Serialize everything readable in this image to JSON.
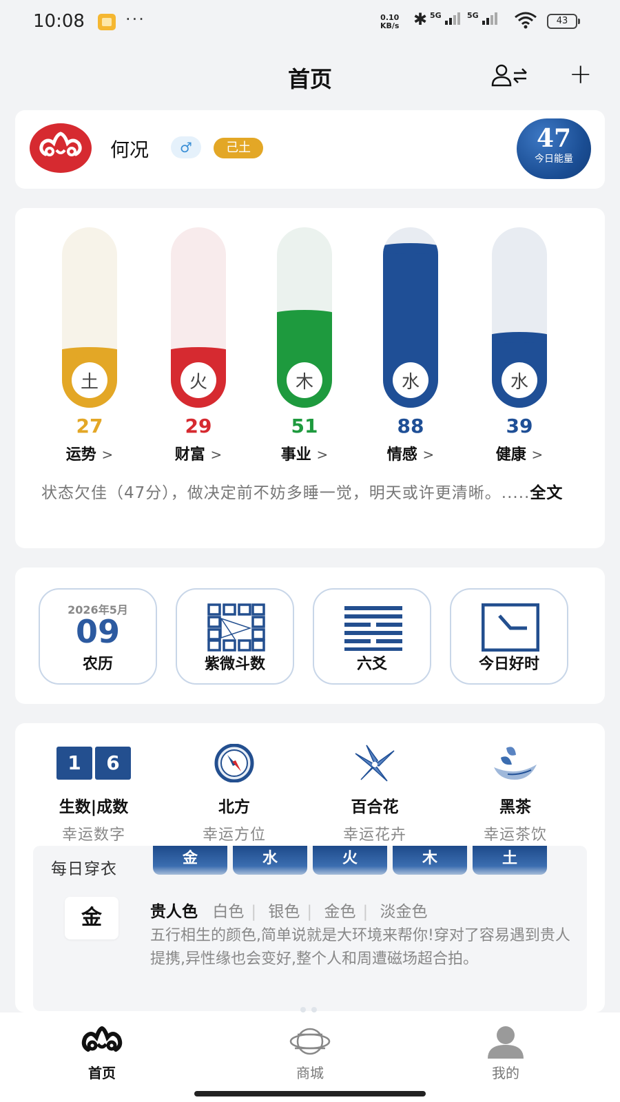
{
  "status_bar": {
    "time": "10:08",
    "net_speed_value": "0.10",
    "net_speed_unit": "KB/s",
    "sig1": "5G",
    "sig2": "5G",
    "battery": "43"
  },
  "header": {
    "title": "首页"
  },
  "profile": {
    "name": "何况",
    "gender_symbol": "♂",
    "element": "己土",
    "energy_value": "47",
    "energy_label": "今日能量"
  },
  "fortune": {
    "items": [
      {
        "element": "土",
        "score": "27",
        "label": "运势",
        "level": 0.27,
        "color": "#e3a726",
        "track": "#f7f3e9"
      },
      {
        "element": "火",
        "score": "29",
        "label": "财富",
        "level": 0.29,
        "color": "#d62a30",
        "track": "#f8ebec"
      },
      {
        "element": "木",
        "score": "51",
        "label": "事业",
        "level": 0.51,
        "color": "#1e9a3e",
        "track": "#ebf2ee"
      },
      {
        "element": "水",
        "score": "88",
        "label": "情感",
        "level": 0.88,
        "color": "#1f4f96",
        "track": "#e8ecf2"
      },
      {
        "element": "水",
        "score": "39",
        "label": "健康",
        "level": 0.39,
        "color": "#1f4f96",
        "track": "#e8ecf2"
      }
    ],
    "arrow": ">",
    "summary": "状态欠佳（47分），做决定前不妨多睡一觉，明天或许更清晰。.....",
    "full_text": "全文"
  },
  "tools": {
    "calendar": {
      "month": "2026年5月",
      "day": "09",
      "label": "农历"
    },
    "ziwei": {
      "label": "紫微斗数"
    },
    "liuyao": {
      "label": "六爻"
    },
    "goodtime": {
      "label": "今日好时"
    }
  },
  "lucky": {
    "number": {
      "digits": [
        "1",
        "6"
      ],
      "name": "生数|成数",
      "sub": "幸运数字"
    },
    "direction": {
      "name": "北方",
      "sub": "幸运方位"
    },
    "flower": {
      "name": "百合花",
      "sub": "幸运花卉"
    },
    "tea": {
      "name": "黑茶",
      "sub": "幸运茶饮"
    }
  },
  "attire": {
    "title": "每日穿衣",
    "tabs": [
      "金",
      "水",
      "火",
      "木",
      "土"
    ],
    "selected": "金",
    "colors_head": "贵人色",
    "colors": [
      "白色",
      "银色",
      "金色",
      "淡金色"
    ],
    "description": "五行相生的颜色,简单说就是大环境来帮你!穿对了容易遇到贵人提携,异性缘也会变好,整个人和周遭磁场超合拍。"
  },
  "nav": {
    "home": "首页",
    "mall": "商城",
    "mine": "我的"
  },
  "colors": {
    "accent_blue": "#1f4f96",
    "brand_red": "#d62a30",
    "gold": "#e3a726"
  }
}
